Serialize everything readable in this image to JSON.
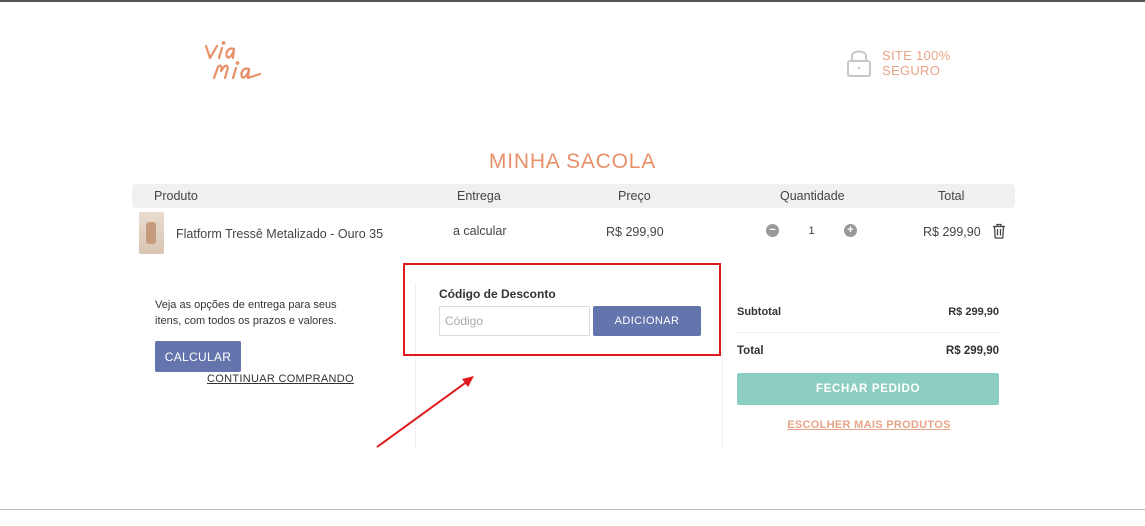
{
  "header": {
    "logo_text": "via mia",
    "secure_line1": "SITE 100%",
    "secure_line2": "SEGURO"
  },
  "page_title": "MINHA SACOLA",
  "table": {
    "headers": {
      "produto": "Produto",
      "entrega": "Entrega",
      "preco": "Preço",
      "quantidade": "Quantidade",
      "total": "Total"
    },
    "rows": [
      {
        "name": "Flatform Tressê Metalizado - Ouro 35",
        "entrega": "a calcular",
        "preco": "R$ 299,90",
        "quantidade": "1",
        "total": "R$ 299,90"
      }
    ]
  },
  "shipping": {
    "text": "Veja as opções de entrega para seus itens, com todos os prazos e valores.",
    "calc_button": "CALCULAR",
    "continue_link": "CONTINUAR COMPRANDO"
  },
  "discount": {
    "label": "Código de Desconto",
    "placeholder": "Código",
    "button": "ADICIONAR"
  },
  "summary": {
    "subtotal_label": "Subtotal",
    "subtotal_value": "R$ 299,90",
    "total_label": "Total",
    "total_value": "R$ 299,90",
    "checkout_button": "FECHAR PEDIDO",
    "more_products_link": "ESCOLHER MAIS PRODUTOS"
  },
  "colors": {
    "brand": "#e8906a",
    "primary_button": "#6475ad",
    "checkout_button": "#8dcec3",
    "annotation": "#e2191c"
  }
}
